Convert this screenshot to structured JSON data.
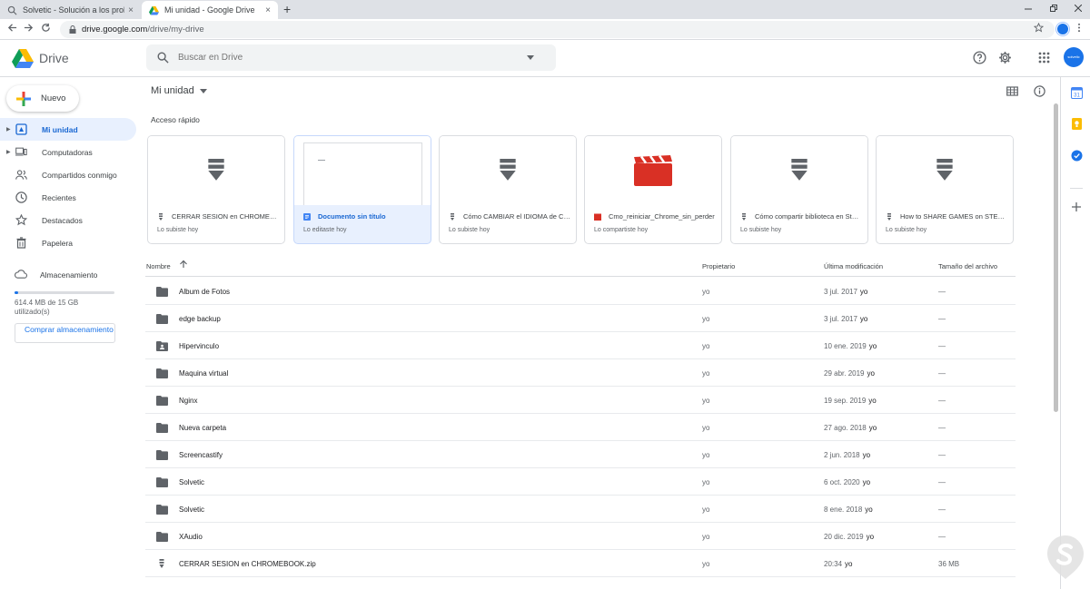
{
  "browser": {
    "tabs": [
      {
        "title": "Solvetic - Solución a los problemas informáticos",
        "active": false
      },
      {
        "title": "Mi unidad - Google Drive",
        "active": true
      }
    ],
    "url_host": "drive.google.com",
    "url_path": "/drive/my-drive",
    "new_tab_glyph": "+",
    "close_glyph": "×"
  },
  "header": {
    "brand": "Drive",
    "search_placeholder": "Buscar en Drive",
    "avatar_text": "solvetic"
  },
  "sidebar": {
    "new_button": "Nuevo",
    "items": [
      {
        "label": "Mi unidad",
        "icon": "my-drive-icon",
        "active": true,
        "expandable": true
      },
      {
        "label": "Computadoras",
        "icon": "computers-icon",
        "active": false,
        "expandable": true
      },
      {
        "label": "Compartidos conmigo",
        "icon": "shared-icon",
        "active": false,
        "expandable": false
      },
      {
        "label": "Recientes",
        "icon": "clock-icon",
        "active": false,
        "expandable": false
      },
      {
        "label": "Destacados",
        "icon": "star-icon",
        "active": false,
        "expandable": false
      },
      {
        "label": "Papelera",
        "icon": "trash-icon",
        "active": false,
        "expandable": false
      }
    ],
    "storage_label": "Almacenamiento",
    "storage_text": "614.4 MB de 15 GB utilizado(s)",
    "storage_fraction": 0.04,
    "buy_storage": "Comprar almacenamiento"
  },
  "main": {
    "title": "Mi unidad",
    "quick_access_label": "Acceso rápido",
    "quick_access": [
      {
        "name": "CERRAR SESION en CHROMEBOOK.zip",
        "sub": "Lo subiste hoy",
        "type": "zip",
        "selected": false
      },
      {
        "name": "Documento sin título",
        "sub": "Lo editaste hoy",
        "type": "doc",
        "selected": true
      },
      {
        "name": "Cómo CAMBIAR el IDIOMA de Chrome",
        "sub": "Lo subiste hoy",
        "type": "zip",
        "selected": false
      },
      {
        "name": "Cmo_reiniciar_Chrome_sin_perder",
        "sub": "Lo compartiste hoy",
        "type": "video",
        "selected": false
      },
      {
        "name": "Cómo compartir biblioteca en Steam",
        "sub": "Lo subiste hoy",
        "type": "zip",
        "selected": false
      },
      {
        "name": "How to SHARE GAMES on STEAM",
        "sub": "Lo subiste hoy",
        "type": "zip",
        "selected": false
      }
    ],
    "columns": {
      "name": "Nombre",
      "owner": "Propietario",
      "modified": "Última modificación",
      "size": "Tamaño del archivo"
    },
    "files": [
      {
        "name": "Album de Fotos",
        "type": "folder",
        "owner": "yo",
        "date": "3 jul. 2017",
        "by": "yo",
        "size": "—"
      },
      {
        "name": "edge backup",
        "type": "folder",
        "owner": "yo",
        "date": "3 jul. 2017",
        "by": "yo",
        "size": "—"
      },
      {
        "name": "Hipervinculo",
        "type": "shared-folder",
        "owner": "yo",
        "date": "10 ene. 2019",
        "by": "yo",
        "size": "—"
      },
      {
        "name": "Maquina virtual",
        "type": "folder",
        "owner": "yo",
        "date": "29 abr. 2019",
        "by": "yo",
        "size": "—"
      },
      {
        "name": "Nginx",
        "type": "folder",
        "owner": "yo",
        "date": "19 sep. 2019",
        "by": "yo",
        "size": "—"
      },
      {
        "name": "Nueva carpeta",
        "type": "folder",
        "owner": "yo",
        "date": "27 ago. 2018",
        "by": "yo",
        "size": "—"
      },
      {
        "name": "Screencastify",
        "type": "folder",
        "owner": "yo",
        "date": "2 jun. 2018",
        "by": "yo",
        "size": "—"
      },
      {
        "name": "Solvetic",
        "type": "folder",
        "owner": "yo",
        "date": "6 oct. 2020",
        "by": "yo",
        "size": "—"
      },
      {
        "name": "Solvetic",
        "type": "folder",
        "owner": "yo",
        "date": "8 ene. 2018",
        "by": "yo",
        "size": "—"
      },
      {
        "name": "XAudio",
        "type": "folder",
        "owner": "yo",
        "date": "20 dic. 2019",
        "by": "yo",
        "size": "—"
      },
      {
        "name": "CERRAR SESION en CHROMEBOOK.zip",
        "type": "zip",
        "owner": "yo",
        "date": "20:34",
        "by": "yo",
        "size": "36 MB"
      }
    ]
  },
  "colors": {
    "accent": "#1a73e8",
    "active_bg": "#e8f0fe",
    "active_text": "#1967d2",
    "folder": "#5f6368",
    "video": "#d93025"
  }
}
